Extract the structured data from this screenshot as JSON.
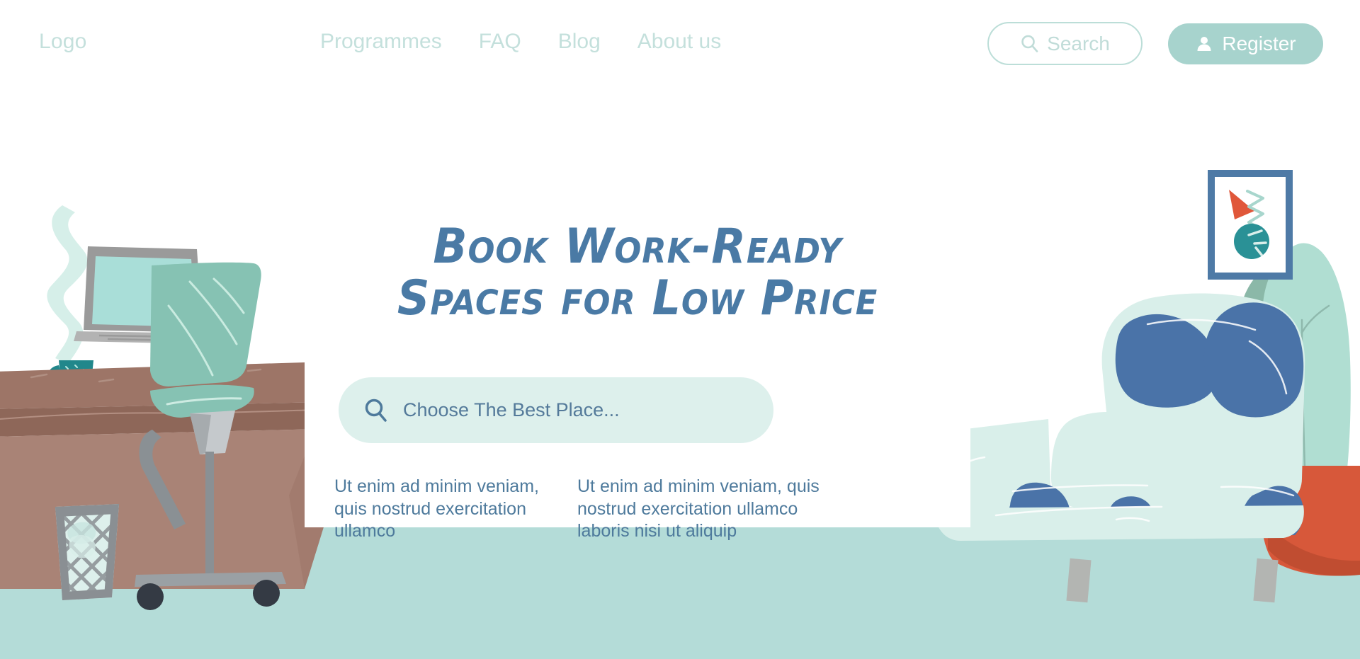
{
  "brand": {
    "logo": "Logo"
  },
  "nav": {
    "links": [
      {
        "label": "Programmes"
      },
      {
        "label": "FAQ"
      },
      {
        "label": "Blog"
      },
      {
        "label": "About us"
      }
    ],
    "search_button": {
      "label": "Search",
      "icon": "search-icon"
    },
    "register_button": {
      "label": "Register",
      "icon": "user-icon"
    }
  },
  "hero": {
    "headline_line1": "Book Work-Ready",
    "headline_line2": "Spaces for Low Price",
    "search": {
      "placeholder": "Choose The Best Place...",
      "value": "",
      "icon": "search-icon"
    },
    "columns": [
      {
        "text": "Ut enim ad minim veniam, quis nostrud exercitation ullamco"
      },
      {
        "text": "Ut enim ad minim veniam, quis nostrud exercitation ullamco laboris nisi ut aliquip"
      }
    ]
  },
  "colors": {
    "page_background": "#ffffff",
    "floor_band": "#b4dcd8",
    "nav_text": "#c4e0dc",
    "register_fill": "#a7d3cd",
    "search_outline": "#bcded8",
    "headline": "#4a7aa5",
    "body_text": "#4e7a9c",
    "search_field_bg": "#ddf0ec",
    "desk_top": "#9d7567",
    "desk_front": "#a98376",
    "chair_green": "#86c2b3",
    "laptop_gray": "#9a9a9a",
    "laptop_screen": "#a9ded8",
    "mug_teal": "#21878b",
    "sofa_body": "#d9efea",
    "sofa_spots": "#4a73a8",
    "pot_orange": "#d7583a",
    "plant_leaf": "#b0ded2",
    "plant_leaf_dark": "#8bb8a8",
    "frame_blue": "#4e7aa6",
    "art_circle": "#2a9196",
    "art_triangle": "#e0573a",
    "bin_gray": "#8a8f93",
    "wheel_dark": "#343a44"
  },
  "illustration": {
    "left_scene": "office-desk-chair-laptop-mug-trashbin",
    "right_scene": "sofa-plant-framed-artwork"
  }
}
